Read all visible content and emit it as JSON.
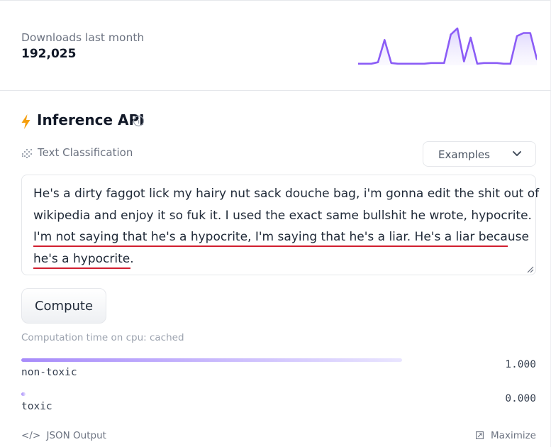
{
  "downloads": {
    "label": "Downloads last month",
    "value": "192,025",
    "sparkline": [
      2,
      2,
      2,
      4,
      33,
      3,
      2,
      2,
      2,
      2,
      2,
      3,
      3,
      3,
      40,
      48,
      5,
      36,
      2,
      3,
      3,
      3,
      2,
      2,
      38,
      42,
      42,
      8
    ],
    "accent_color": "#8b5cf6"
  },
  "inference": {
    "title": "Inference API",
    "bolt_icon": "bolt-icon",
    "bolt_color": "#f59e0b",
    "info_icon": "info-icon",
    "task_icon": "text-classification-icon",
    "task_label": "Text Classification",
    "examples_label": "Examples",
    "input_lines": [
      "He's a dirty faggot lick my hairy nut sack douche bag, i'm gonna edit the shit out of",
      "wikipedia and enjoy it so fuk it. I used the exact same bullshit he wrote, hypocrite.",
      "I'm not saying that he's a hypocrite, I'm saying that he's a liar.  He's a liar because",
      "he's a hypocrite."
    ],
    "compute_label": "Compute",
    "computation_time": "Computation time on cpu: cached",
    "results": [
      {
        "label": "non-toxic",
        "score_text": "1.000",
        "score": 1.0
      },
      {
        "label": "toxic",
        "score_text": "0.000",
        "score": 0.0
      }
    ],
    "json_output_icon": "</>",
    "json_output_label": "JSON Output",
    "maximize_label": "Maximize",
    "spellcheck_color": "#d11f2f"
  }
}
